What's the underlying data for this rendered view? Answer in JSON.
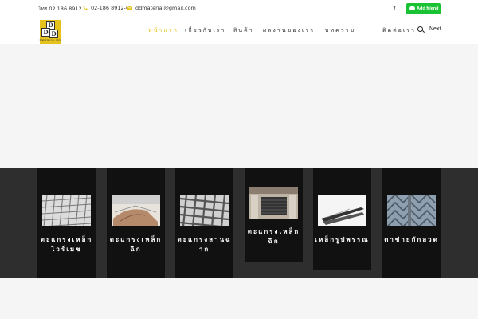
{
  "topbar": {
    "phone_label": "โทร 02 186 8912",
    "fax": "02-186 8912-6",
    "email": "ddmaterial@gmail.com",
    "line_button": "Add friend",
    "facebook_glyph": "f"
  },
  "logo": {
    "top_letter": "D",
    "mid_letter": "D",
    "bottom_letter": "D",
    "caption": "Material Co., Ltd."
  },
  "nav": {
    "items": [
      "หน้าแรก",
      "เกี่ยวกับเรา",
      "สินค้า",
      "ผลงานของเรา",
      "บทความ",
      "ติดต่อเรา"
    ],
    "next_label": "Next"
  },
  "cards": [
    {
      "title": "ตะแกรงเหล็กไวร์เมช",
      "image": "wire-mesh-panels"
    },
    {
      "title": "ตะแกรงเหล็กฉีก",
      "image": "steel-sheet-roll"
    },
    {
      "title": "ตะแกรงสานฉาก",
      "image": "woven-grating"
    },
    {
      "title": "ตะแกรงเหล็กฉีก",
      "image": "expanded-metal-wall"
    },
    {
      "title": "เหล็กรูปพรรณ",
      "image": "steel-profiles"
    },
    {
      "title": "ตาข่ายถักลวด",
      "image": "chain-link-fence"
    }
  ],
  "colors": {
    "accent": "#e6c21c",
    "line_green": "#19c232",
    "band": "#2e2e2e",
    "card": "#111111"
  }
}
